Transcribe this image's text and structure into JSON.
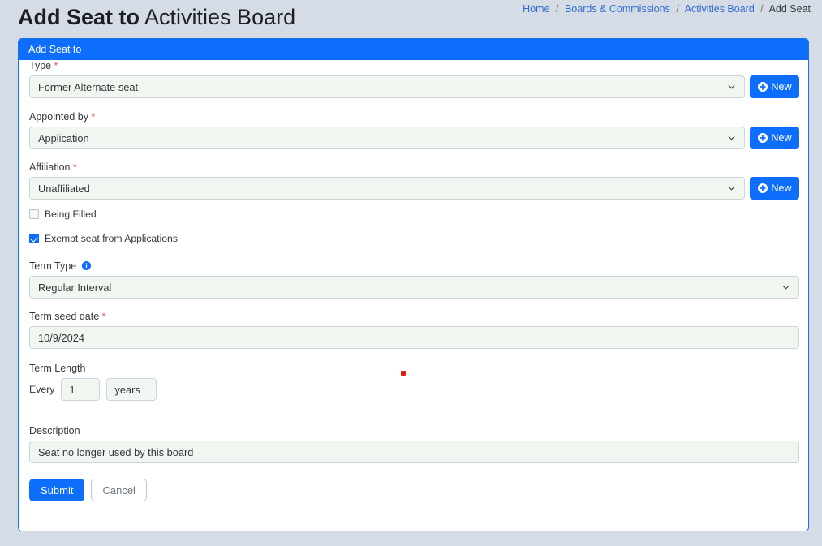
{
  "header": {
    "title_strong": "Add Seat to",
    "title_light": "Activities Board",
    "breadcrumb": [
      {
        "label": "Home",
        "link": true
      },
      {
        "label": "Boards & Commissions",
        "link": true
      },
      {
        "label": "Activities Board",
        "link": true
      },
      {
        "label": "Add Seat",
        "link": false
      }
    ],
    "separator": "/"
  },
  "card": {
    "header_title": "Add Seat to"
  },
  "form": {
    "type": {
      "label": "Type",
      "required_marker": "*",
      "value": "Former Alternate seat",
      "new_button": "New"
    },
    "appointed_by": {
      "label": "Appointed by",
      "required_marker": "*",
      "value": "Application",
      "new_button": "New"
    },
    "affiliation": {
      "label": "Affiliation",
      "required_marker": "*",
      "value": "Unaffiliated",
      "new_button": "New"
    },
    "being_filled": {
      "label": "Being Filled",
      "checked": false
    },
    "exempt_seat": {
      "label": "Exempt seat from Applications",
      "checked": true
    },
    "term_type": {
      "label": "Term Type",
      "value": "Regular Interval",
      "info_icon": "info-circle-icon"
    },
    "term_seed_date": {
      "label": "Term seed date",
      "required_marker": "*",
      "value": "10/9/2024"
    },
    "term_length": {
      "label": "Term Length",
      "every_label": "Every",
      "amount": "1",
      "unit": "years"
    },
    "description": {
      "label": "Description",
      "value": "Seat no longer used by this board"
    },
    "actions": {
      "submit": "Submit",
      "cancel": "Cancel"
    }
  },
  "colors": {
    "primary": "#0d6efd",
    "page_bg": "#d6dce6",
    "input_bg": "#f0f7f1",
    "required": "#e2564c",
    "cursor": "#e01b0f"
  }
}
